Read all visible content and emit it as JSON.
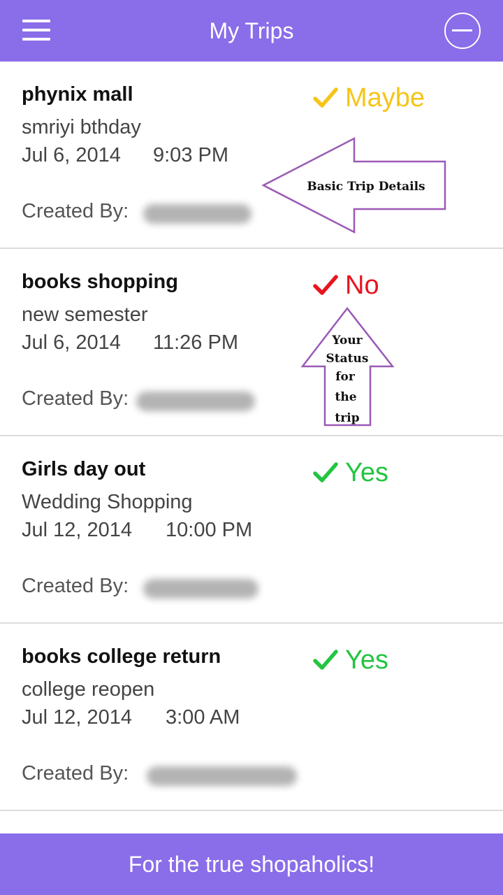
{
  "header": {
    "title": "My Trips",
    "menu_icon": "hamburger-menu-icon",
    "action_icon": "circle-minus-icon",
    "background_color": "#8a6de9"
  },
  "trips": [
    {
      "name": "phynix mall",
      "description": "smriyi bthday",
      "date": "Jul 6, 2014",
      "time": "9:03 PM",
      "created_by_label": "Created By:",
      "status": "Maybe",
      "status_color": "#f5c518",
      "status_icon": "check-icon"
    },
    {
      "name": "books shopping",
      "description": "new semester",
      "date": "Jul 6, 2014",
      "time": "11:26 PM",
      "created_by_label": "Created By:",
      "status": "No",
      "status_color": "#e8141e",
      "status_icon": "check-icon"
    },
    {
      "name": "Girls day out",
      "description": "Wedding Shopping",
      "date": "Jul 12, 2014",
      "time": "10:00 PM",
      "created_by_label": "Created By:",
      "status": "Yes",
      "status_color": "#22c540",
      "status_icon": "check-icon"
    },
    {
      "name": "books college return",
      "description": "college reopen",
      "date": "Jul 12, 2014",
      "time": "3:00 AM",
      "created_by_label": "Created By:",
      "status": "Yes",
      "status_color": "#22c540",
      "status_icon": "check-icon"
    }
  ],
  "annotations": {
    "details": "Basic Trip Details",
    "status_lines": [
      "Your",
      "Status",
      "for",
      "the",
      "trip"
    ],
    "outline_color": "#9b59b6"
  },
  "footer": {
    "text": "For the true shopaholics!",
    "background_color": "#8a6de9"
  }
}
